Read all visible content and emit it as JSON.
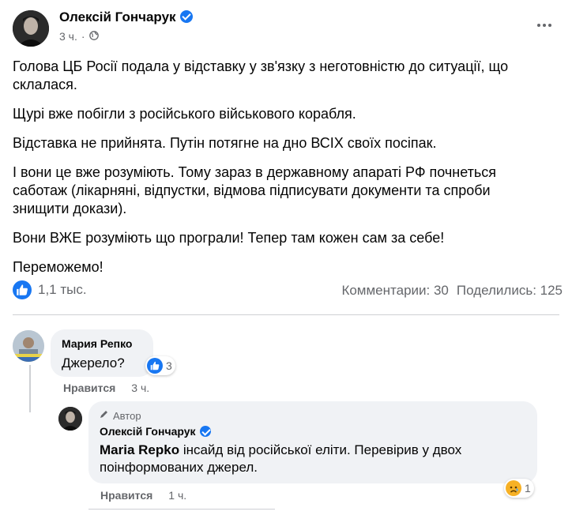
{
  "post": {
    "author": "Олексій Гончарук",
    "time": "3 ч.",
    "paragraphs": [
      "Голова ЦБ Росії подала у відставку у зв'язку з неготовністю до ситуації, що склалася.",
      "Щурі вже побігли з російського військового корабля.",
      "Відставка не прийнята. Путін потягне на дно ВСІХ своїх посіпак.",
      "І вони це вже розуміють. Тому зараз в державному апараті РФ почнеться саботаж (лікарняні, відпустки, відмова підписувати документи та спроби знищити докази).",
      "Вони ВЖЕ розуміють що програли! Тепер там кожен сам за себе!",
      "Переможемо!"
    ],
    "likes": "1,1 тыс.",
    "comments": "Комментарии: 30",
    "shares": "Поделились: 125"
  },
  "comment1": {
    "author": "Мария Репко",
    "text": "Джерело?",
    "reactions": "3",
    "like_label": "Нравится",
    "time": "3 ч."
  },
  "reply": {
    "badge": "Автор",
    "author": "Олексій Гончарук",
    "mention": "Maria Repko",
    "text": " інсайд від російської еліти. Перевірив у двох поінформованих джерел.",
    "reactions": "1",
    "like_label": "Нравится",
    "time": "1 ч."
  },
  "colors": {
    "accent": "#1877f2",
    "muted": "#65676b"
  }
}
